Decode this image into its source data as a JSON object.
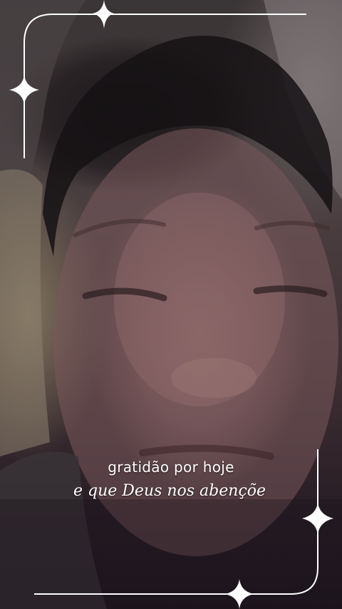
{
  "story": {
    "caption_line_1": "gratidão por hoje",
    "caption_line_2": "e que Deus nos abençõe"
  },
  "decoration": {
    "frame_color": "#ffffff",
    "sparkle_icon": "four-point-star-icon"
  }
}
